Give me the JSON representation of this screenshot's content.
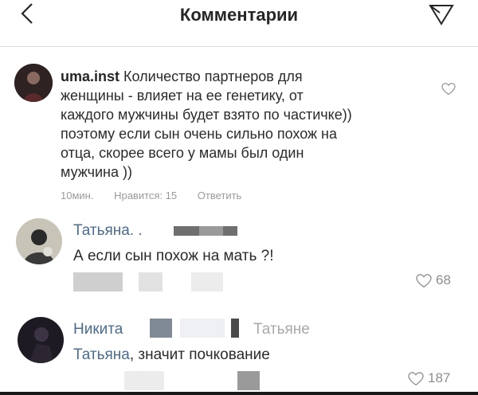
{
  "header": {
    "title": "Комментарии",
    "back_icon": "chevron-left-icon",
    "send_icon": "paper-plane-icon"
  },
  "comments": [
    {
      "username": "uma.inst",
      "lines": [
        "Количество партнеров для",
        "женщины - влияет на ее генетику, от",
        "каждого мужчины будет взято по частичке))",
        "поэтому если сын очень сильно похож на",
        "отца, скорее всего у мамы был один",
        "мужчина ))"
      ],
      "time": "10мин.",
      "likes": "Нравится: 15",
      "reply": "Ответить"
    },
    {
      "username": "Татьяна",
      "suffix": ". .",
      "text": "А если сын похож на мать ?!",
      "like_count": "68"
    },
    {
      "username": "Никита",
      "mention_grey": "Татьяне",
      "mention": "Татьяна",
      "text": ", значит почкование",
      "like_count": "187"
    }
  ],
  "colors": {
    "link": "#4a6c8f",
    "secondary": "#9a9a9a",
    "divider": "#dbdbdb"
  }
}
